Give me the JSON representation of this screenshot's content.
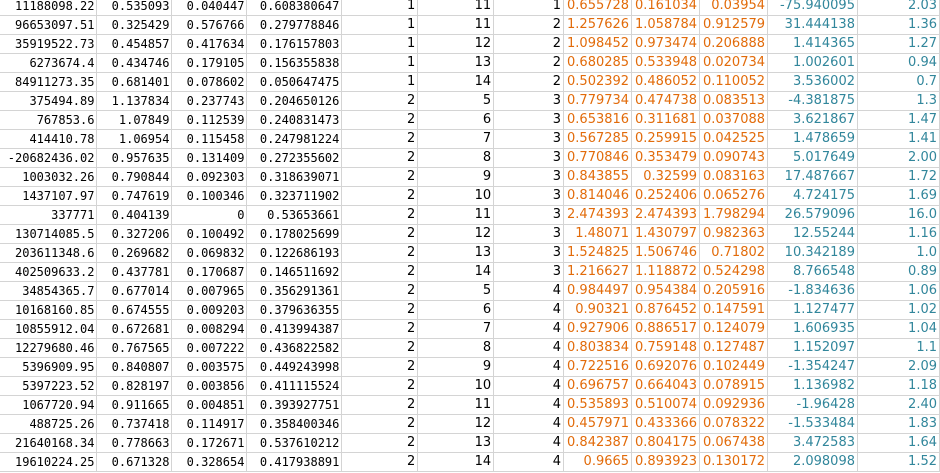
{
  "colors": {
    "orange": "#e26b0a",
    "teal": "#31869b",
    "grid": "#d4d4d4"
  },
  "rows": [
    [
      "11188098.22",
      "0.535093",
      "0.040447",
      "0.608380647",
      "1",
      "11",
      "1",
      "0.655728",
      "0.161034",
      "0.03954",
      "-75.940095",
      "2.03"
    ],
    [
      "96653097.51",
      "0.325429",
      "0.576766",
      "0.279778846",
      "1",
      "11",
      "2",
      "1.257626",
      "1.058784",
      "0.912579",
      "31.444138",
      "1.36"
    ],
    [
      "35919522.73",
      "0.454857",
      "0.417634",
      "0.176157803",
      "1",
      "12",
      "2",
      "1.098452",
      "0.973474",
      "0.206888",
      "1.414365",
      "1.27"
    ],
    [
      "6273674.4",
      "0.434746",
      "0.179105",
      "0.156355838",
      "1",
      "13",
      "2",
      "0.680285",
      "0.533948",
      "0.020734",
      "1.002601",
      "0.94"
    ],
    [
      "84911273.35",
      "0.681401",
      "0.078602",
      "0.050647475",
      "1",
      "14",
      "2",
      "0.502392",
      "0.486052",
      "0.110052",
      "3.536002",
      "0.7"
    ],
    [
      "375494.89",
      "1.137834",
      "0.237743",
      "0.204650126",
      "2",
      "5",
      "3",
      "0.779734",
      "0.474738",
      "0.083513",
      "-4.381875",
      "1.3"
    ],
    [
      "767853.6",
      "1.07849",
      "0.112539",
      "0.240831473",
      "2",
      "6",
      "3",
      "0.653816",
      "0.311681",
      "0.037088",
      "3.621867",
      "1.47"
    ],
    [
      "414410.78",
      "1.06954",
      "0.115458",
      "0.247981224",
      "2",
      "7",
      "3",
      "0.567285",
      "0.259915",
      "0.042525",
      "1.478659",
      "1.41"
    ],
    [
      "-20682436.02",
      "0.957635",
      "0.131409",
      "0.272355602",
      "2",
      "8",
      "3",
      "0.770846",
      "0.353479",
      "0.090743",
      "5.017649",
      "2.00"
    ],
    [
      "1003032.26",
      "0.790844",
      "0.092303",
      "0.318639071",
      "2",
      "9",
      "3",
      "0.843855",
      "0.32599",
      "0.083163",
      "17.487667",
      "1.72"
    ],
    [
      "1437107.97",
      "0.747619",
      "0.100346",
      "0.323711902",
      "2",
      "10",
      "3",
      "0.814046",
      "0.252406",
      "0.065276",
      "4.724175",
      "1.69"
    ],
    [
      "337771",
      "0.404139",
      "0",
      "0.53653661",
      "2",
      "11",
      "3",
      "2.474393",
      "2.474393",
      "1.798294",
      "26.579096",
      "16.0"
    ],
    [
      "130714085.5",
      "0.327206",
      "0.100492",
      "0.178025699",
      "2",
      "12",
      "3",
      "1.48071",
      "1.430797",
      "0.982363",
      "12.55244",
      "1.16"
    ],
    [
      "203611348.6",
      "0.269682",
      "0.069832",
      "0.122686193",
      "2",
      "13",
      "3",
      "1.524825",
      "1.506746",
      "0.71802",
      "10.342189",
      "1.0"
    ],
    [
      "402509633.2",
      "0.437781",
      "0.170687",
      "0.146511692",
      "2",
      "14",
      "3",
      "1.216627",
      "1.118872",
      "0.524298",
      "8.766548",
      "0.89"
    ],
    [
      "34854365.7",
      "0.677014",
      "0.007965",
      "0.356291361",
      "2",
      "5",
      "4",
      "0.984497",
      "0.954384",
      "0.205916",
      "-1.834636",
      "1.06"
    ],
    [
      "10168160.85",
      "0.674555",
      "0.009203",
      "0.379636355",
      "2",
      "6",
      "4",
      "0.90321",
      "0.876452",
      "0.147591",
      "1.127477",
      "1.02"
    ],
    [
      "10855912.04",
      "0.672681",
      "0.008294",
      "0.413994387",
      "2",
      "7",
      "4",
      "0.927906",
      "0.886517",
      "0.124079",
      "1.606935",
      "1.04"
    ],
    [
      "12279680.46",
      "0.767565",
      "0.007222",
      "0.436822582",
      "2",
      "8",
      "4",
      "0.803834",
      "0.759148",
      "0.127487",
      "1.152097",
      "1.1"
    ],
    [
      "5396909.95",
      "0.840807",
      "0.003575",
      "0.449243998",
      "2",
      "9",
      "4",
      "0.722516",
      "0.692076",
      "0.102449",
      "-1.354247",
      "2.09"
    ],
    [
      "5397223.52",
      "0.828197",
      "0.003856",
      "0.411115524",
      "2",
      "10",
      "4",
      "0.696757",
      "0.664043",
      "0.078915",
      "1.136982",
      "1.18"
    ],
    [
      "1067720.94",
      "0.911665",
      "0.004851",
      "0.393927751",
      "2",
      "11",
      "4",
      "0.535893",
      "0.510074",
      "0.092936",
      "-1.96428",
      "2.40"
    ],
    [
      "488725.26",
      "0.737418",
      "0.114917",
      "0.358400346",
      "2",
      "12",
      "4",
      "0.457971",
      "0.433366",
      "0.078322",
      "-1.533484",
      "1.83"
    ],
    [
      "21640168.34",
      "0.778663",
      "0.172671",
      "0.537610212",
      "2",
      "13",
      "4",
      "0.842387",
      "0.804175",
      "0.067438",
      "3.472583",
      "1.64"
    ],
    [
      "19610224.25",
      "0.671328",
      "0.328654",
      "0.417938891",
      "2",
      "14",
      "4",
      "0.9665",
      "0.893923",
      "0.130172",
      "2.098098",
      "1.52"
    ]
  ]
}
